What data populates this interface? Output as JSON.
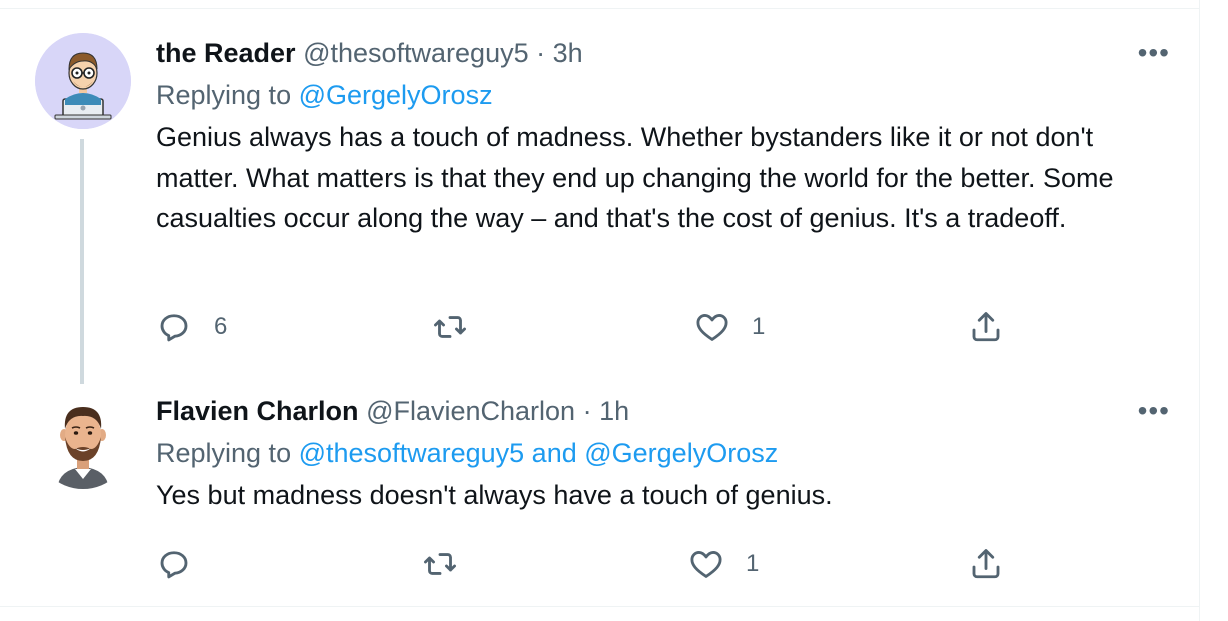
{
  "tweets": [
    {
      "name": "the Reader",
      "handle": "@thesoftwareguy5",
      "separator": "·",
      "time": "3h",
      "replying_prefix": "Replying to",
      "replying_handles": [
        "@GergelyOrosz"
      ],
      "replying_conjunction": "",
      "text": "Genius always has a touch of madness. Whether bystanders like it or not don't matter. What matters is that they end up changing the world for the better. Some casualties occur along the way – and that's the cost of genius. It's a tradeoff.",
      "more_label": "•••",
      "replies": "6",
      "retweets": "",
      "likes": "1",
      "avatar_icon": "cartoon-reader-avatar"
    },
    {
      "name": "Flavien Charlon",
      "handle": "@FlavienCharlon",
      "separator": "·",
      "time": "1h",
      "replying_prefix": "Replying to",
      "replying_handles": [
        "@thesoftwareguy5",
        "@GergelyOrosz"
      ],
      "replying_conjunction": "and",
      "text": "Yes but madness doesn't always have a touch of genius.",
      "more_label": "•••",
      "replies": "",
      "retweets": "",
      "likes": "1",
      "avatar_icon": "cartoon-bearded-man-avatar"
    }
  ],
  "colors": {
    "link": "#1d9bf0",
    "secondary": "#536471",
    "text": "#0f1419",
    "thread_line": "#cfd9de"
  }
}
